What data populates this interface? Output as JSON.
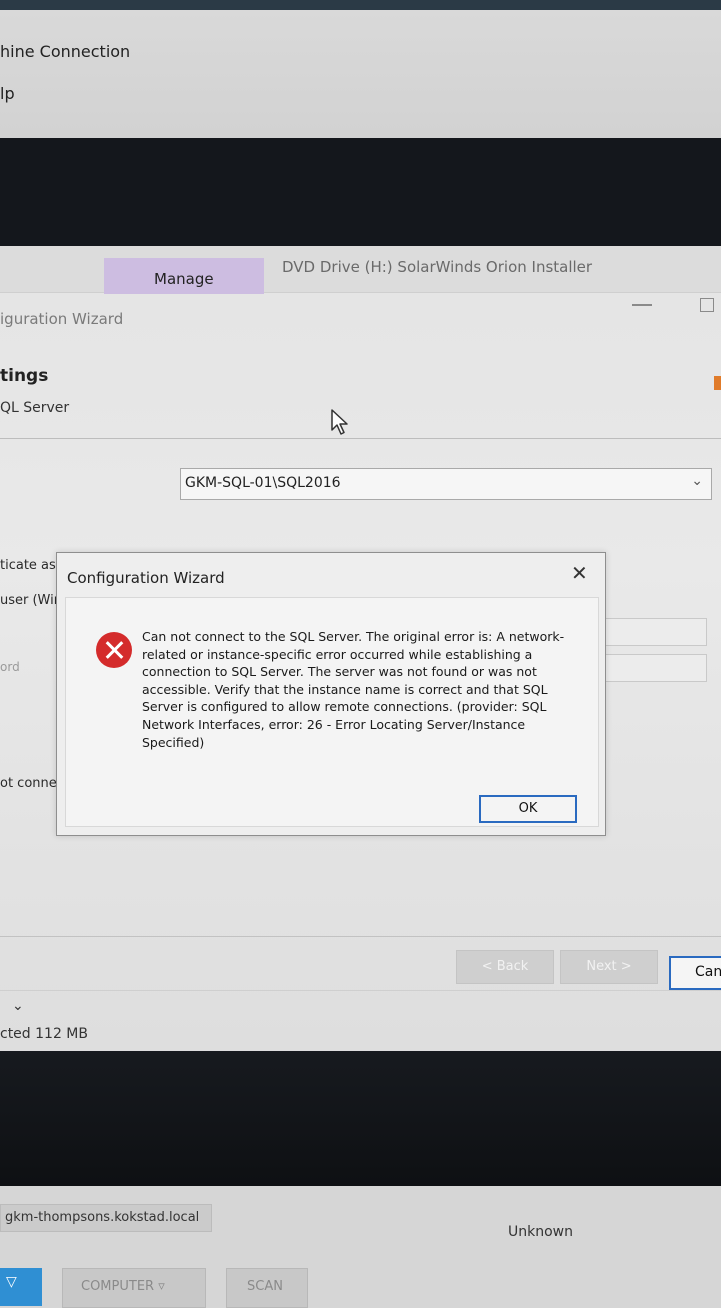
{
  "remote_window": {
    "menu_line1": "hine Connection",
    "menu_line2": "lp"
  },
  "explorer": {
    "ribbon_tab": "Manage",
    "drive_title": "DVD Drive (H:) SolarWinds Orion Installer"
  },
  "wizard": {
    "window_title": "iguration Wizard",
    "heading": "tings",
    "subheading": "QL Server",
    "server_value": "GKM-SQL-01\\SQL2016",
    "auth_label": "ticate as",
    "user_label": "user (Wir",
    "password_label": "ord",
    "connect_label": "ot connect",
    "back_label": "< Back",
    "next_label": "Next >",
    "cancel_label": "Can"
  },
  "status_bar": {
    "size_text": "cted  112 MB"
  },
  "dialog": {
    "title": "Configuration Wizard",
    "close_glyph": "✕",
    "message": "Can not connect to the SQL Server. The original error is: A network-related or instance-specific error occurred while establishing a connection to SQL Server. The server was not found or was not accessible. Verify that the instance name is correct and that SQL Server is configured to allow remote connections. (provider: SQL Network Interfaces, error: 26 - Error Locating Server/Instance Specified)",
    "ok_label": "OK"
  },
  "bottom_panel": {
    "host": "gkm-thompsons.kokstad.local",
    "status": "Unknown",
    "computer_button": "COMPUTER ▿",
    "scan_button": "SCAN"
  },
  "icons": {
    "error": "error-icon",
    "cursor": "mouse-cursor-icon",
    "dropdown": "chevron-down-icon"
  },
  "colors": {
    "manage_tab": "#cdbde1",
    "error_red": "#d42b2b",
    "focus_blue": "#2a6ac0",
    "bottom_button_blue": "#2f8fd3"
  }
}
